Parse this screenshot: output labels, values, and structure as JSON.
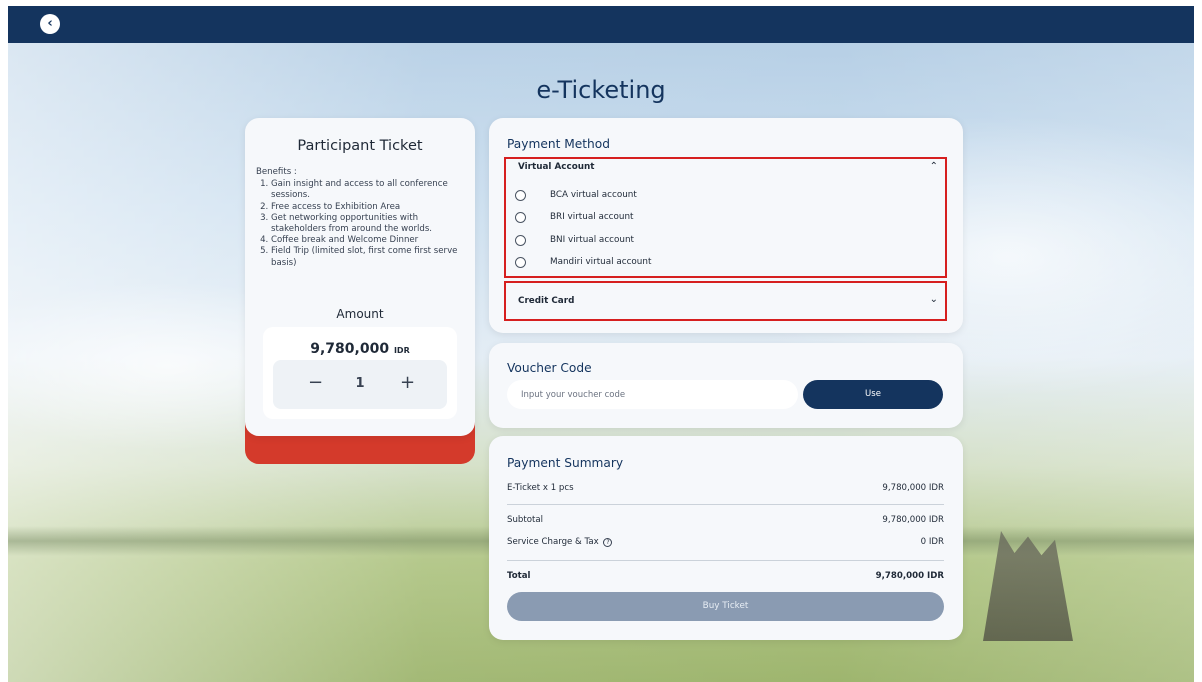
{
  "header": {
    "back_icon": "chevron-left-icon"
  },
  "page": {
    "title": "e-Ticketing"
  },
  "ticket": {
    "title": "Participant Ticket",
    "benefits_label": "Benefits :",
    "benefits": [
      "Gain insight and access to all conference sessions.",
      "Free access to Exhibition Area",
      "Get networking opportunities with stakeholders from around the worlds.",
      "Coffee break and Welcome Dinner",
      "Field Trip (limited slot, first come first serve basis)"
    ],
    "amount_label": "Amount",
    "amount_value": "9,780,000",
    "amount_unit": "IDR",
    "quantity": "1",
    "minus_symbol": "−",
    "plus_symbol": "+"
  },
  "payment_method": {
    "title": "Payment Method",
    "virtual_account": {
      "label": "Virtual Account",
      "expanded": true,
      "options": [
        "BCA virtual account",
        "BRI virtual account",
        "BNI virtual account",
        "Mandiri virtual account"
      ]
    },
    "credit_card": {
      "label": "Credit Card",
      "expanded": false
    },
    "chevron_up": "⌃",
    "chevron_down": "⌄"
  },
  "voucher": {
    "title": "Voucher Code",
    "placeholder": "Input your voucher code",
    "button_label": "Use"
  },
  "summary": {
    "title": "Payment Summary",
    "item_label": "E-Ticket x 1 pcs",
    "item_value": "9,780,000 IDR",
    "subtotal_label": "Subtotal",
    "subtotal_value": "9,780,000 IDR",
    "service_label": "Service Charge & Tax",
    "service_value": "0 IDR",
    "total_label": "Total",
    "total_value": "9,780,000 IDR",
    "buy_label": "Buy Ticket"
  },
  "colors": {
    "navy": "#14345e",
    "accent_red": "#d43a2b",
    "highlight_border": "#d61f1f",
    "disabled_button": "#8a9bb2"
  }
}
